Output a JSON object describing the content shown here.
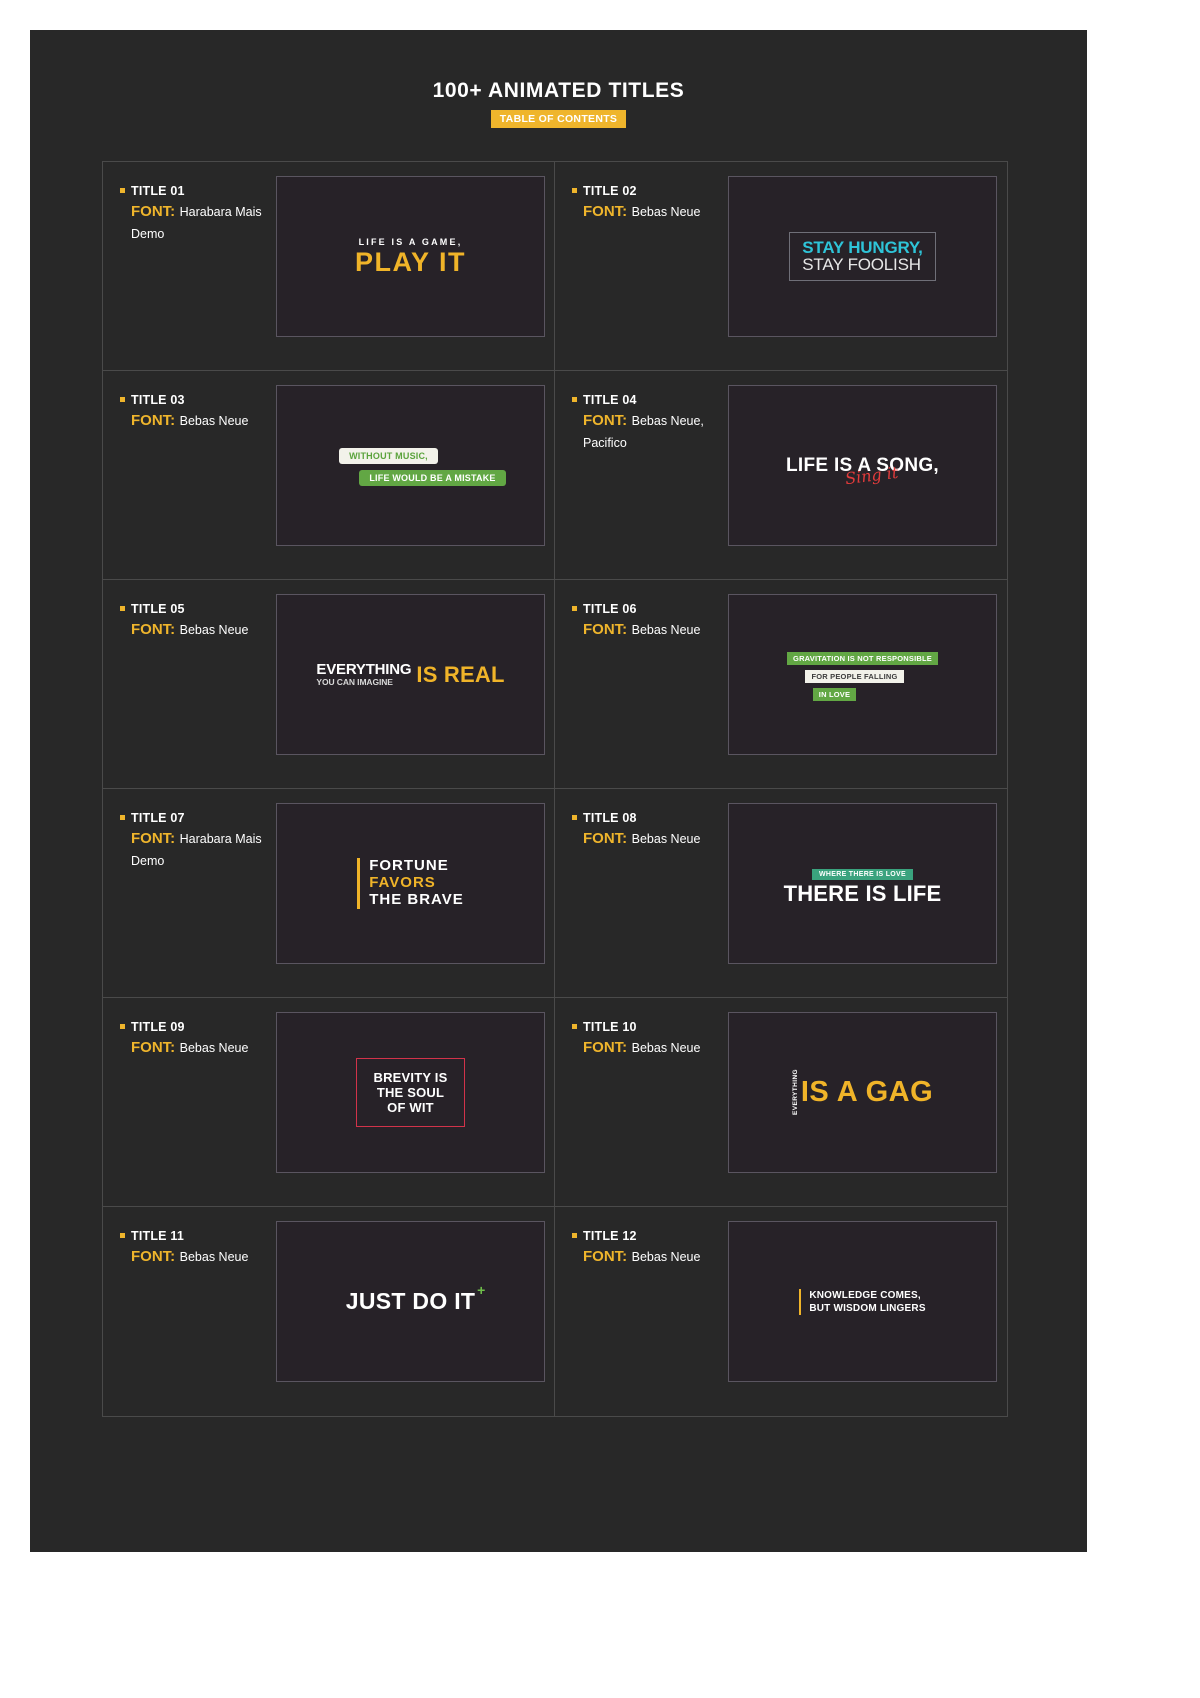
{
  "header": {
    "title": "100+ ANIMATED TITLES",
    "badge": "TABLE OF CONTENTS"
  },
  "labels": {
    "font_key": "FONT:"
  },
  "items": [
    {
      "title": "TITLE 01",
      "font": "Harabara Mais Demo",
      "preview": {
        "line1": "LIFE IS A GAME,",
        "line2": "PLAY  IT"
      }
    },
    {
      "title": "TITLE 02",
      "font": "Bebas Neue",
      "preview": {
        "line1": "STAY HUNGRY,",
        "line2": "STAY FOOLISH"
      }
    },
    {
      "title": "TITLE 03",
      "font": "Bebas Neue",
      "preview": {
        "line1": "WITHOUT MUSIC,",
        "line2": "LIFE WOULD BE A MISTAKE"
      }
    },
    {
      "title": "TITLE 04",
      "font": "Bebas Neue, Pacifico",
      "preview": {
        "line1": "LIFE IS A SONG,",
        "line2": "Sing it"
      }
    },
    {
      "title": "TITLE 05",
      "font": "Bebas Neue",
      "preview": {
        "line1": "EVERYTHING",
        "line2": "YOU CAN IMAGINE",
        "line3": "IS REAL"
      }
    },
    {
      "title": "TITLE 06",
      "font": "Bebas Neue",
      "preview": {
        "line1": "GRAVITATION IS NOT RESPONSIBLE",
        "line2": "FOR PEOPLE FALLING",
        "line3": "IN LOVE"
      }
    },
    {
      "title": "TITLE 07",
      "font": "Harabara Mais Demo",
      "preview": {
        "line1": "FORTUNE",
        "line2": "FAVORS",
        "line3": "THE  BRAVE"
      }
    },
    {
      "title": "TITLE 08",
      "font": "Bebas Neue",
      "preview": {
        "line1": "WHERE THERE IS LOVE",
        "line2": "THERE IS LIFE"
      }
    },
    {
      "title": "TITLE 09",
      "font": "Bebas Neue",
      "preview": {
        "line1": "BREVITY IS",
        "line2": "THE SOUL",
        "line3": "OF WIT"
      }
    },
    {
      "title": "TITLE 10",
      "font": "Bebas Neue",
      "preview": {
        "line1": "EVERYTHING",
        "line2": "IS A GAG"
      }
    },
    {
      "title": "TITLE 11",
      "font": "Bebas Neue",
      "preview": {
        "line1": "JUST DO IT",
        "line2": "+"
      }
    },
    {
      "title": "TITLE 12",
      "font": "Bebas Neue",
      "preview": {
        "line1": "KNOWLEDGE COMES,",
        "line2": "BUT WISDOM LINGERS"
      }
    }
  ],
  "colors": {
    "page_bg": "#282828",
    "accent_yellow": "#efb52c",
    "thumb_bg": "#272228",
    "green": "#62a744",
    "cyan": "#2ec4d8",
    "red": "#d2334a",
    "teal": "#3aa37e"
  }
}
